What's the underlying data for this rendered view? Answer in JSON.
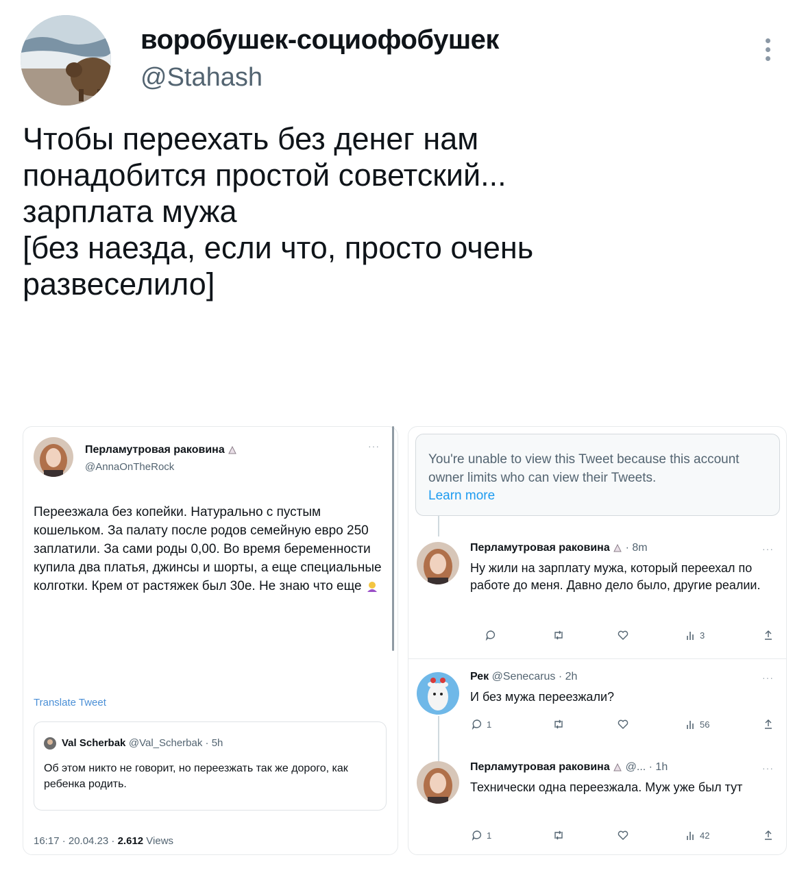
{
  "tweet": {
    "display_name": "воробушек-социофобушек",
    "handle": "@Stahash",
    "text": "Чтобы переехать без денег нам\nпонадобится простой советский...\nзарплата мужа\n[без наезда, если что, просто очень\nразвеселило]"
  },
  "left": {
    "author_name": "Перламутровая раковина",
    "author_handle": "@AnnaOnTheRock",
    "text": "Переезжала без копейки. Натурально с пустым кошельком. За палату после родов семейную евро 250 заплатили. За сами роды 0,00. Во время беременности купила два платья, джинсы и шорты, а еще специальные колготки. Крем от растяжек был 30е. Не знаю что еще",
    "translate": "Translate Tweet",
    "quote": {
      "name": "Val Scherbak",
      "meta": "@Val_Scherbak · 5h",
      "text": "Об этом никто не говорит, но переезжать так же дорого, как ребенка родить."
    },
    "footer_time": "16:17 · 20.04.23 · ",
    "footer_views": "2.612",
    "footer_views_label": " Views"
  },
  "right": {
    "notice_text": "You're unable to view this Tweet because this account owner limits who can view their Tweets.",
    "notice_link": "Learn more",
    "replies": [
      {
        "name": "Перламутровая раковина",
        "meta": " · 8m",
        "text": "Ну жили на зарплату мужа, который переехал по работе до меня. Давно дело было, другие реалии.",
        "reply_count": "",
        "views": "3"
      },
      {
        "name": "Рек",
        "meta": "@Senecarus · 2h",
        "text": "И без мужа переезжали?",
        "reply_count": "1",
        "views": "56"
      },
      {
        "name": "Перламутровая раковина",
        "meta": "@... · 1h",
        "text": "Технически одна переезжала. Муж уже был тут",
        "reply_count": "1",
        "views": "42"
      }
    ]
  },
  "icons": [
    "more-vertical-icon",
    "shell-emoji-icon",
    "shrug-emoji-icon",
    "reply-icon",
    "retweet-icon",
    "like-icon",
    "views-icon",
    "share-icon"
  ],
  "colors": {
    "link": "#1d9bf0",
    "muted": "#536471",
    "translate": "#4a8fd6"
  }
}
